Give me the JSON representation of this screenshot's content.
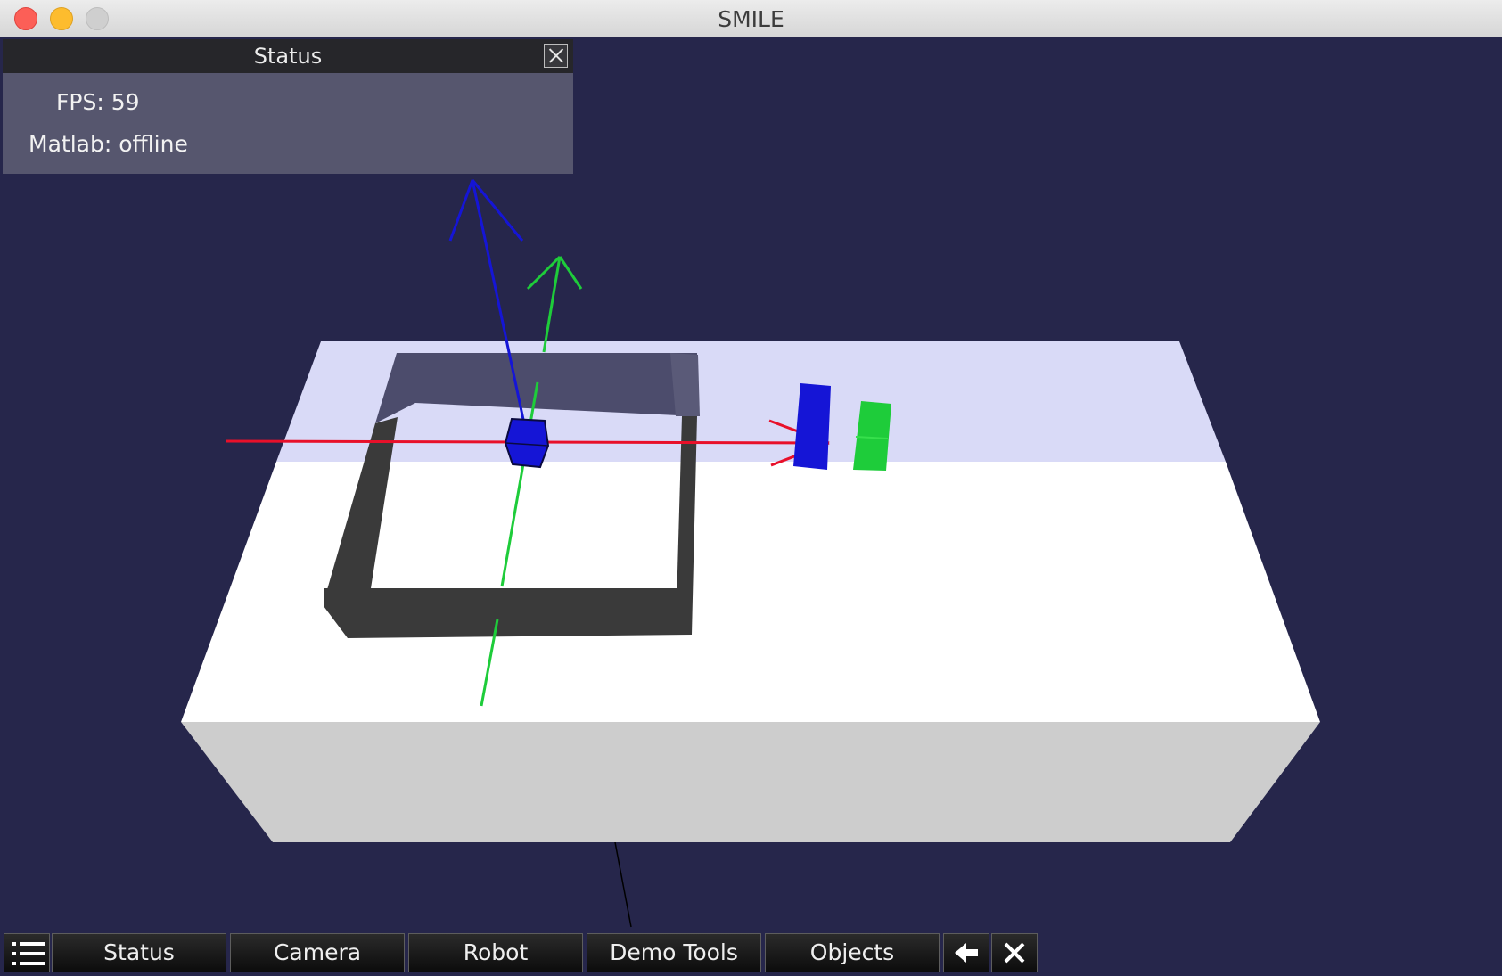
{
  "window": {
    "title": "SMILE"
  },
  "status_panel": {
    "title": "Status",
    "fps_label": "FPS:",
    "fps_value": "59",
    "matlab_label": "Matlab:",
    "matlab_value": "offline"
  },
  "toolbar": {
    "buttons": [
      "Status",
      "Camera",
      "Robot",
      "Demo Tools",
      "Objects"
    ]
  },
  "icons": {
    "menu": "list-icon",
    "back": "arrow-left-icon",
    "close": "close-icon"
  },
  "colors": {
    "background": "#26264b",
    "axis_x": "#e8102a",
    "axis_y": "#1ecc3a",
    "axis_z": "#1515d6",
    "table_top": "#ffffff",
    "table_side": "#cdcdcd",
    "tray": "#3a3a3a"
  }
}
